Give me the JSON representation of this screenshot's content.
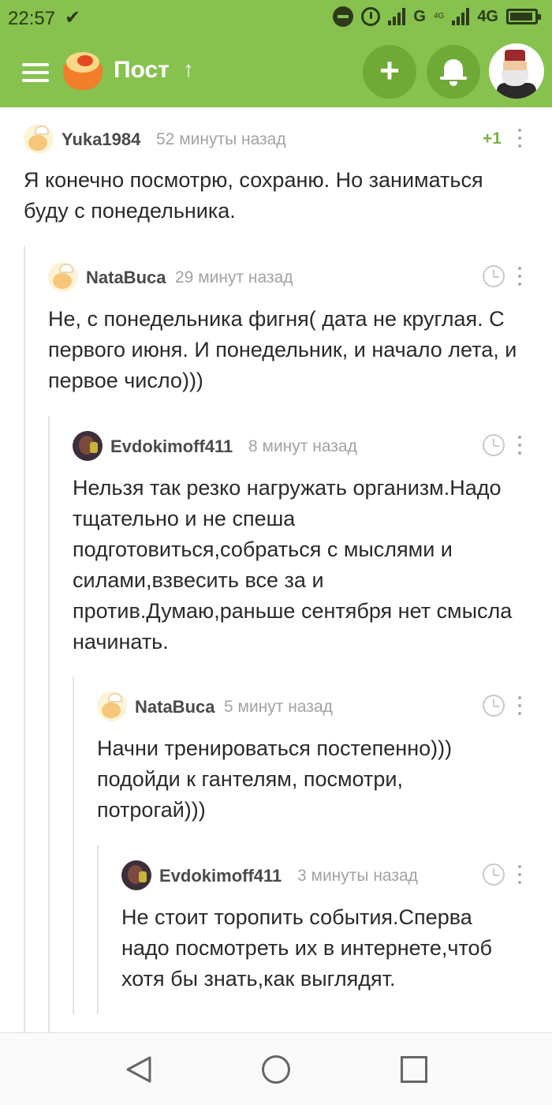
{
  "status_bar": {
    "time": "22:57",
    "check_icon": "check-mark-icon",
    "network_1": "G",
    "network_2": "4G",
    "network_2_small": "4G",
    "icons": [
      "do-not-disturb-icon",
      "alarm-icon",
      "signal-icon",
      "signal-icon",
      "battery-icon"
    ]
  },
  "app_bar": {
    "menu_icon": "hamburger-menu-icon",
    "logo": "pikabu-logo-icon",
    "title": "Пост",
    "sort_icon": "arrow-up-icon",
    "add_icon": "plus-icon",
    "notifications_icon": "bell-icon",
    "profile_icon": "user-avatar",
    "accent_color": "#86c24d"
  },
  "comments": [
    {
      "author": "Yuka1984",
      "time": "52 минуты назад",
      "rating": "+1",
      "avatar": "cook-avatar",
      "text": "Я конечно посмотрю, сохраню. Но заниматься буду с понедельника."
    },
    {
      "author": "NataBuca",
      "time": "29 минут назад",
      "avatar": "cook-avatar",
      "text": "Не, с понедельника фигня( дата не круглая. С первого июня. И понедельник, и начало лета, и первое число)))"
    },
    {
      "author": "Evdokimoff411",
      "time": "8 минут назад",
      "avatar": "photo-avatar",
      "text": "Нельзя так резко нагружать организм.Надо тщательно и не спеша подготовиться,собраться с мыслями и силами,взвесить все за и против.Думаю,раньше сентября нет смысла начинать."
    },
    {
      "author": "NataBuca",
      "time": "5 минут назад",
      "avatar": "cook-avatar",
      "text": "Начни тренироваться постепенно))) подойди к гантелям, посмотри, потрогай)))"
    },
    {
      "author": "Evdokimoff411",
      "time": "3 минуты назад",
      "avatar": "photo-avatar",
      "text": "Не стоит торопить события.Сперва надо посмотреть их в интернете,чтоб хотя бы знать,как выглядят."
    }
  ],
  "nav_bar": {
    "back_icon": "back-triangle-icon",
    "home_icon": "home-circle-icon",
    "recents_icon": "recents-square-icon"
  }
}
